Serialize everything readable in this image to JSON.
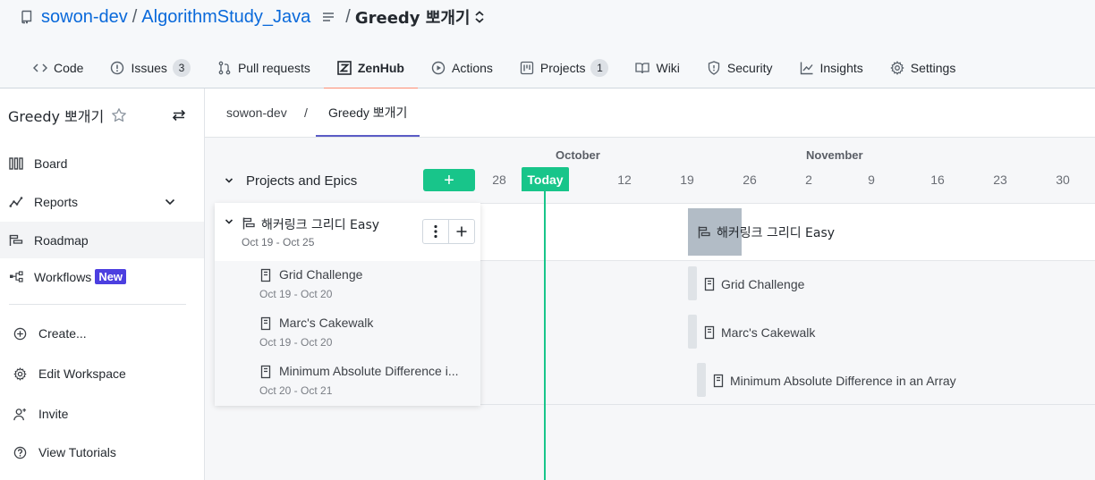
{
  "repo": {
    "owner": "sowon-dev",
    "separator": "/",
    "name": "AlgorithmStudy_Java",
    "separator2": "/",
    "workspace": "Greedy 뽀개기"
  },
  "tabs": [
    {
      "label": "Code",
      "icon": "code-icon"
    },
    {
      "label": "Issues",
      "icon": "issue-icon",
      "count": "3"
    },
    {
      "label": "Pull requests",
      "icon": "pull-request-icon"
    },
    {
      "label": "ZenHub",
      "icon": "zenhub-icon",
      "active": true
    },
    {
      "label": "Actions",
      "icon": "play-icon"
    },
    {
      "label": "Projects",
      "icon": "project-icon",
      "count": "1"
    },
    {
      "label": "Wiki",
      "icon": "book-icon"
    },
    {
      "label": "Security",
      "icon": "shield-icon"
    },
    {
      "label": "Insights",
      "icon": "graph-icon"
    },
    {
      "label": "Settings",
      "icon": "gear-icon"
    }
  ],
  "sidebar": {
    "workspace_title": "Greedy 뽀개기",
    "nav": [
      {
        "label": "Board",
        "icon": "board-icon"
      },
      {
        "label": "Reports",
        "icon": "reports-icon"
      },
      {
        "label": "Roadmap",
        "icon": "roadmap-icon",
        "active": true
      },
      {
        "label": "Workflows",
        "icon": "workflows-icon",
        "badge": "New"
      }
    ],
    "actions": [
      {
        "label": "Create...",
        "icon": "plus-circle-icon"
      },
      {
        "label": "Edit Workspace",
        "icon": "gear-icon"
      },
      {
        "label": "Invite",
        "icon": "person-add-icon"
      },
      {
        "label": "View Tutorials",
        "icon": "question-icon"
      }
    ]
  },
  "breadcrumbs": {
    "root": "sowon-dev",
    "separator": "/",
    "current": "Greedy 뽀개기"
  },
  "timeline": {
    "months": [
      "October",
      "November"
    ],
    "days": [
      "28",
      "12",
      "19",
      "26",
      "2",
      "9",
      "16",
      "23",
      "30"
    ],
    "today_label": "Today",
    "section_title": "Projects and Epics",
    "add_label": "+"
  },
  "epic": {
    "name": "해커링크 그리디 Easy",
    "dates": "Oct 19 - Oct 25",
    "issues": [
      {
        "name": "Grid Challenge",
        "dates": "Oct 19 - Oct 20"
      },
      {
        "name": "Marc's Cakewalk",
        "dates": "Oct 19 - Oct 20"
      },
      {
        "name": "Minimum Absolute Difference i...",
        "bar_name": "Minimum Absolute Difference in an Array",
        "dates": "Oct 20 - Oct 21"
      }
    ]
  },
  "colors": {
    "link": "#0969da",
    "accent_green": "#18c58a",
    "tab_underline": "#fd8c73",
    "new_badge": "#4c3fe0",
    "crumb_underline": "#5b5cc6"
  }
}
